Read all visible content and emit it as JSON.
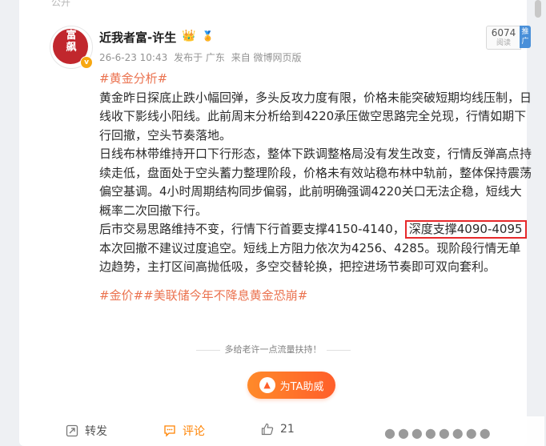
{
  "header": {
    "top_strip": "公开"
  },
  "post": {
    "username": "近我者富-许生",
    "avatar_text": "富\n飙",
    "meta": {
      "date": "26-6-23 10:43",
      "published_from": "发布于 广东",
      "source": "来自 微博网页版"
    },
    "views": {
      "count": "6074",
      "label": "阅读"
    },
    "promo": "推广",
    "topic_tag": "#黄金分析#",
    "paragraphs": [
      "黄金昨日探底止跌小幅回弹，多头反攻力度有限，价格未能突破短期均线压制，日线收下影线小阳线。此前周末分析给到4220承压做空思路完全兑现，行情如期下行回撤，空头节奏落地。",
      "日线布林带维持开口下行形态，整体下跌调整格局没有发生改变，行情反弹高点持续走低，盘面处于空头蓄力整理阶段，价格未有效站稳布林中轨前，整体保持震荡偏空基调。4小时周期结构同步偏弱，此前明确强调4220关口无法企稳，短线大概率二次回撤下行。"
    ],
    "p3_before": "后市交易思路维持不变，行情下行首要支撑4150-4140，",
    "p3_highlight": "深度支撑4090-4095",
    "p3_after": "本次回撤不建议过度追空。短线上方阻力依次为4256、4285。现阶段行情无单边趋势，主打区间高抛低吸，多空交替轮换，把控进场节奏即可双向套利。",
    "footer_tags": "#金价##美联储今年不降息黄金恐崩#",
    "support_note": "多给老许一点流量扶持！",
    "boost_label": "为TA助威"
  },
  "actions": {
    "repost": "转发",
    "comment": "评论",
    "like": "21"
  },
  "colors": {
    "accent": "#eb7350",
    "highlight_border": "#e6292b",
    "boost": "#ff6a2a"
  }
}
